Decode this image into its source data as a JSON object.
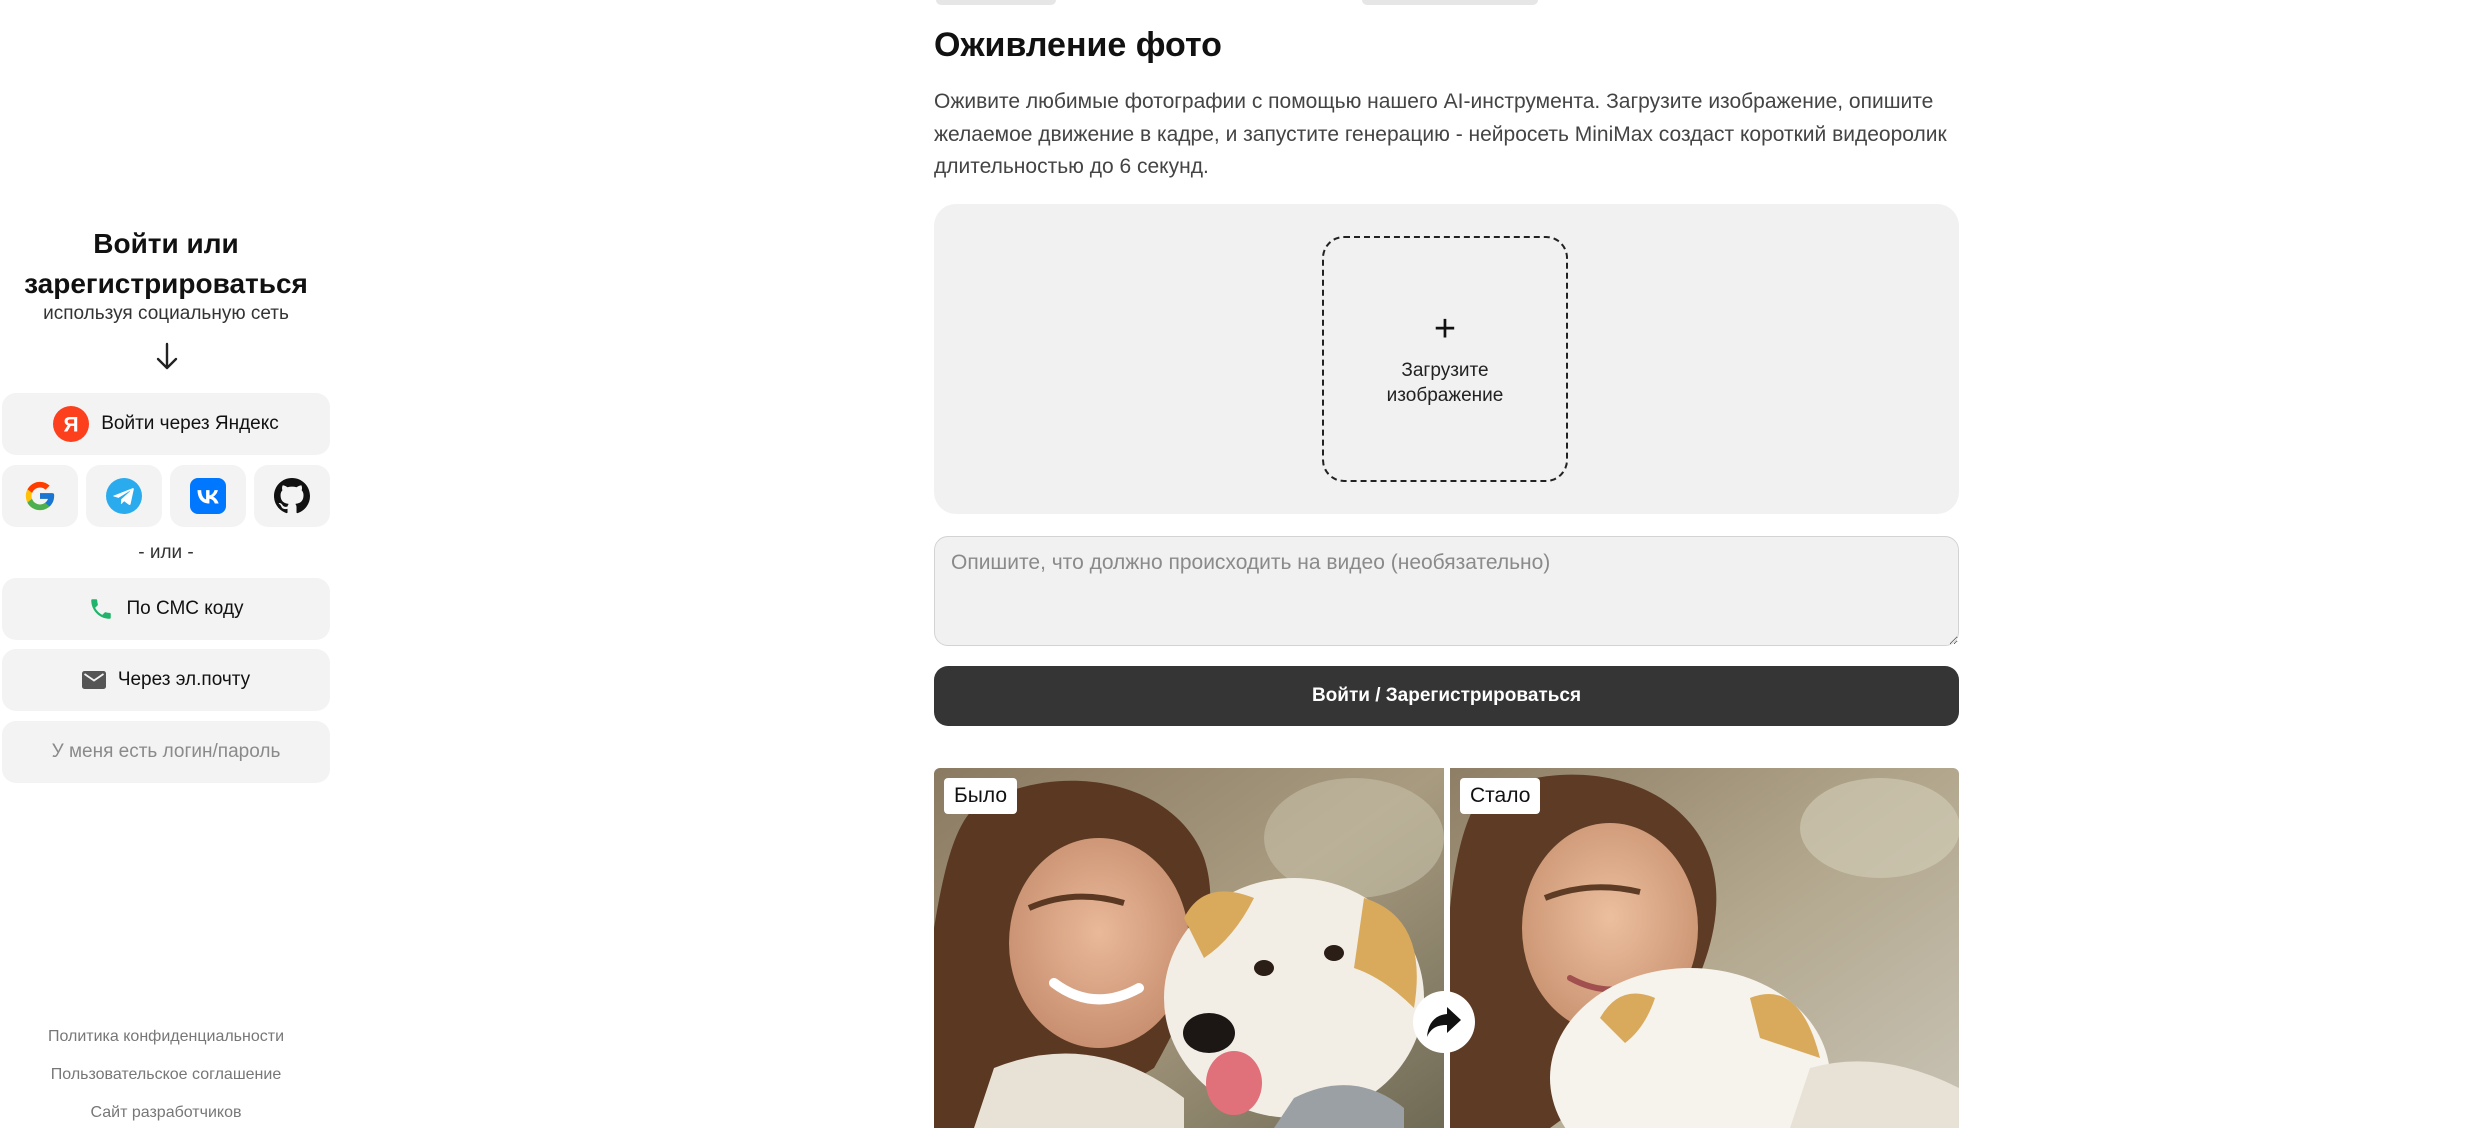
{
  "auth": {
    "title": "Войти или зарегистрироваться",
    "subtitle": "используя социальную сеть",
    "yandex_label": "Войти через Яндекс",
    "yandex_letter": "Я",
    "social_icons": [
      "google-icon",
      "telegram-icon",
      "vk-icon",
      "github-icon"
    ],
    "or_text": "- или -",
    "sms_label": "По СМС коду",
    "email_label": "Через эл.почту",
    "login_label": "У меня есть логин/пароль"
  },
  "footer": {
    "privacy": "Политика конфиденциальности",
    "terms": "Пользовательское соглашение",
    "dev_site": "Сайт разработчиков"
  },
  "main": {
    "title": "Оживление фото",
    "description": "Оживите любимые фотографии с помощью нашего AI-инструмента. Загрузите изображение, опишите желаемое движение в кадре, и запустите генерацию - нейросеть MiniMax создаст короткий видеоролик длительностью до 6 секунд.",
    "upload_plus": "+",
    "upload_label": "Загрузите изображение",
    "prompt_placeholder": "Опишите, что должно происходить на видео (необязательно)",
    "submit_label": "Войти / Зарегистрироваться",
    "before_label": "Было",
    "after_label": "Стало"
  },
  "colors": {
    "yandex": "#fc3f1d",
    "telegram": "#2aabee",
    "vk": "#0077ff",
    "phone": "#1fb46a",
    "button_dark": "#353535"
  }
}
